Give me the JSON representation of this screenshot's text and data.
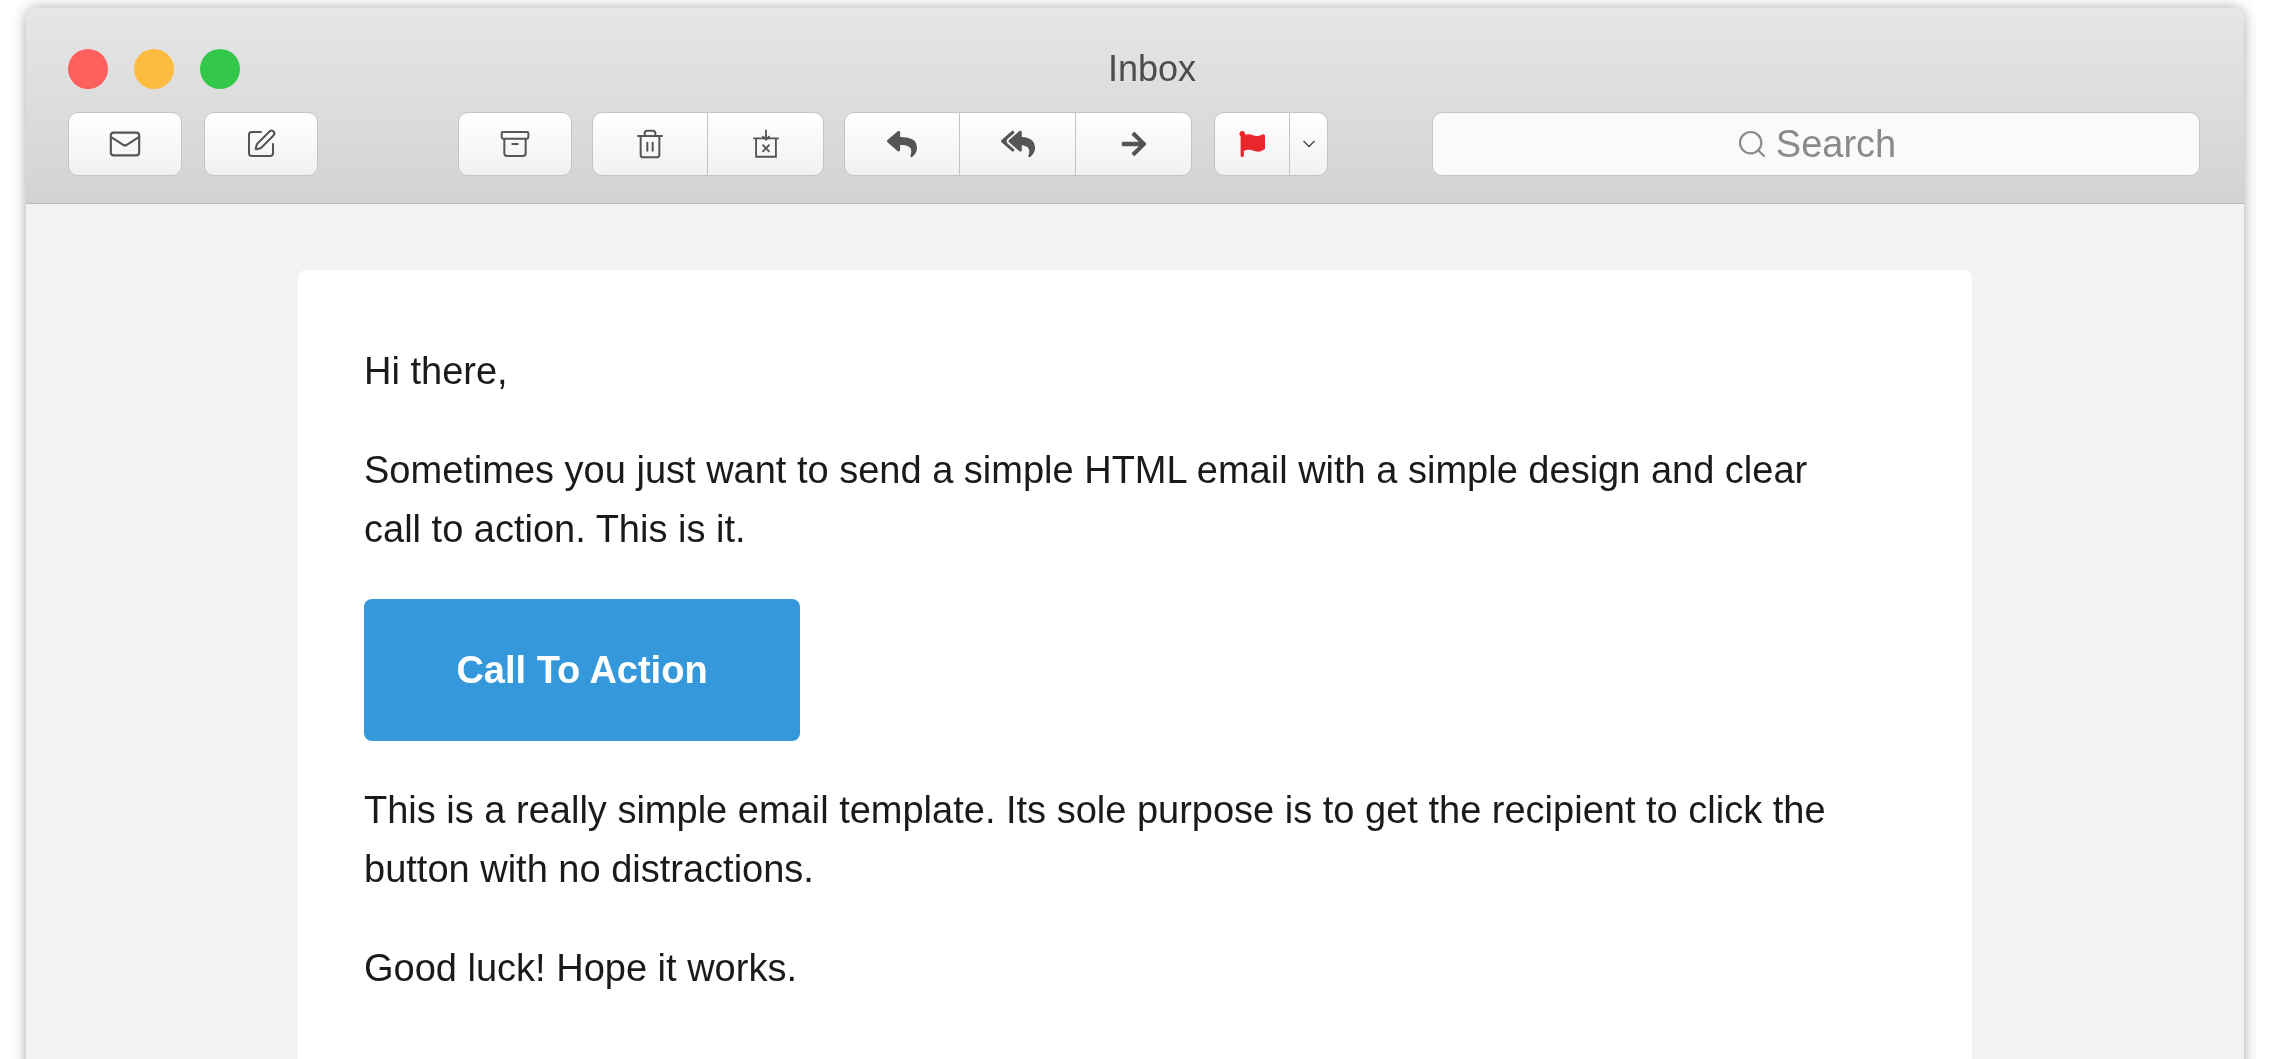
{
  "window": {
    "title": "Inbox"
  },
  "search": {
    "placeholder": "Search"
  },
  "email": {
    "blocks": [
      {
        "kind": "text",
        "text": "Hi there,"
      },
      {
        "kind": "text",
        "text": "Sometimes you just want to send a simple HTML email with a simple design and clear call to action. This is it."
      },
      {
        "kind": "button",
        "text": "Call To Action"
      },
      {
        "kind": "text",
        "text": "This is a really simple email template. Its sole purpose is to get the recipient to click the button with no distractions."
      },
      {
        "kind": "text",
        "text": "Good luck! Hope it works."
      }
    ]
  }
}
